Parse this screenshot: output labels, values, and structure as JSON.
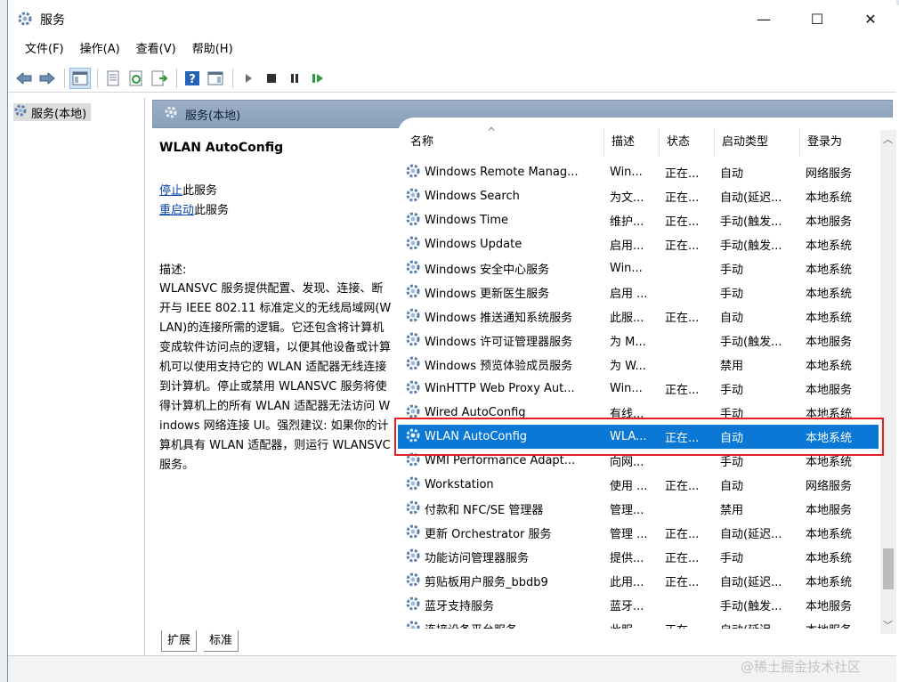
{
  "window": {
    "title": "服务",
    "minimize": "—",
    "maximize": "☐",
    "close": "✕"
  },
  "menu": [
    "文件(F)",
    "操作(A)",
    "查看(V)",
    "帮助(H)"
  ],
  "tree": {
    "root_label": "服务(本地)"
  },
  "pane": {
    "header": "服务(本地)"
  },
  "details": {
    "service_name": "WLAN AutoConfig",
    "stop_link": "停止",
    "stop_suffix": "此服务",
    "restart_link": "重启动",
    "restart_suffix": "此服务",
    "desc_label": "描述:",
    "desc_text": "WLANSVC 服务提供配置、发现、连接、断开与 IEEE 802.11 标准定义的无线局域网(WLAN)的连接所需的逻辑。它还包含将计算机变成软件访问点的逻辑，以便其他设备或计算机可以使用支持它的 WLAN 适配器无线连接到计算机。停止或禁用 WLANSVC 服务将使得计算机上的所有 WLAN 适配器无法访问 Windows 网络连接 UI。强烈建议: 如果你的计算机具有 WLAN 适配器，则运行 WLANSVC 服务。"
  },
  "columns": {
    "name": "名称",
    "desc": "描述",
    "status": "状态",
    "startup": "启动类型",
    "logon": "登录为"
  },
  "services": [
    {
      "name": "Windows Remote Manag...",
      "desc": "Win...",
      "status": "正在...",
      "startup": "自动",
      "logon": "网络服务"
    },
    {
      "name": "Windows Search",
      "desc": "为文...",
      "status": "正在...",
      "startup": "自动(延迟...",
      "logon": "本地系统"
    },
    {
      "name": "Windows Time",
      "desc": "维护...",
      "status": "正在...",
      "startup": "手动(触发...",
      "logon": "本地服务"
    },
    {
      "name": "Windows Update",
      "desc": "启用...",
      "status": "正在...",
      "startup": "手动(触发...",
      "logon": "本地系统"
    },
    {
      "name": "Windows 安全中心服务",
      "desc": "Win...",
      "status": "",
      "startup": "手动",
      "logon": "本地系统"
    },
    {
      "name": "Windows 更新医生服务",
      "desc": "启用 ...",
      "status": "",
      "startup": "手动",
      "logon": "本地系统"
    },
    {
      "name": "Windows 推送通知系统服务",
      "desc": "此服...",
      "status": "正在...",
      "startup": "自动",
      "logon": "本地系统"
    },
    {
      "name": "Windows 许可证管理器服务",
      "desc": "为 M...",
      "status": "",
      "startup": "手动(触发...",
      "logon": "本地服务"
    },
    {
      "name": "Windows 预览体验成员服务",
      "desc": "为 W...",
      "status": "",
      "startup": "禁用",
      "logon": "本地系统"
    },
    {
      "name": "WinHTTP Web Proxy Aut...",
      "desc": "Win...",
      "status": "正在...",
      "startup": "手动",
      "logon": "本地服务"
    },
    {
      "name": "Wired AutoConfig",
      "desc": "有线...",
      "status": "",
      "startup": "手动",
      "logon": "本地系统"
    },
    {
      "name": "WLAN AutoConfig",
      "desc": "WLA...",
      "status": "正在...",
      "startup": "自动",
      "logon": "本地系统",
      "selected": true
    },
    {
      "name": "WMI Performance Adapt...",
      "desc": "向网...",
      "status": "",
      "startup": "手动",
      "logon": "本地系统"
    },
    {
      "name": "Workstation",
      "desc": "使用 ...",
      "status": "正在...",
      "startup": "自动",
      "logon": "网络服务"
    },
    {
      "name": "付款和 NFC/SE 管理器",
      "desc": "管理...",
      "status": "",
      "startup": "禁用",
      "logon": "本地服务"
    },
    {
      "name": "更新 Orchestrator 服务",
      "desc": "管理 ...",
      "status": "正在...",
      "startup": "自动(延迟...",
      "logon": "本地系统"
    },
    {
      "name": "功能访问管理器服务",
      "desc": "提供...",
      "status": "正在...",
      "startup": "手动",
      "logon": "本地系统"
    },
    {
      "name": "剪贴板用户服务_bbdb9",
      "desc": "此用...",
      "status": "正在...",
      "startup": "自动(延迟...",
      "logon": "本地系统"
    },
    {
      "name": "蓝牙支持服务",
      "desc": "蓝牙...",
      "status": "",
      "startup": "手动(触发...",
      "logon": "本地服务"
    },
    {
      "name": "连接设备平台服务",
      "desc": "此服...",
      "status": "正在...",
      "startup": "自动(延迟...",
      "logon": "本地服务"
    }
  ],
  "tabs": [
    "扩展",
    "标准"
  ],
  "watermark": "@稀土掘金技术社区",
  "colors": {
    "selection": "#0a78d4",
    "highlight_box": "#e41e26",
    "pane_header": "#9aadc4"
  }
}
